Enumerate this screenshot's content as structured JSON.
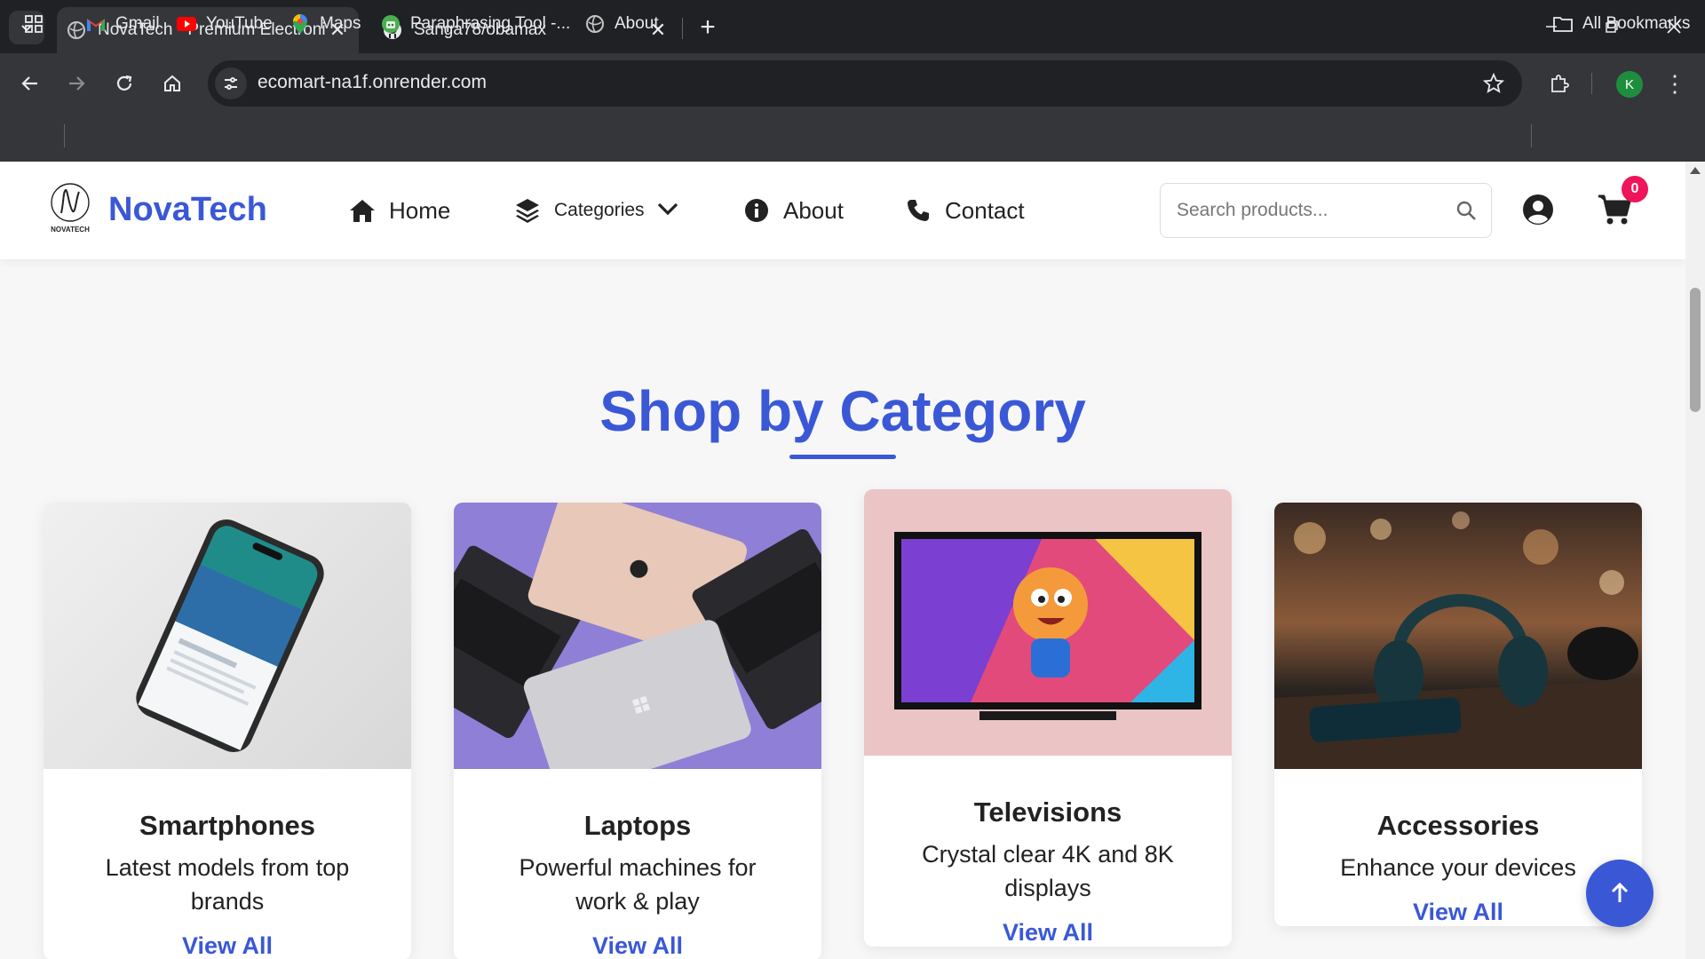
{
  "browser": {
    "tabs": [
      {
        "title": "NovaTech - Premium Electronics",
        "active": true
      },
      {
        "title": "Sanga78/obamax",
        "active": false
      }
    ],
    "url": "ecomart-na1f.onrender.com",
    "profile_initial": "K",
    "bookmarks": [
      "Gmail",
      "YouTube",
      "Maps",
      "Paraphrasing Tool -...",
      "About"
    ],
    "all_bookmarks": "All Bookmarks"
  },
  "site": {
    "brand": "NovaTech",
    "logo_text": "NOVATECH",
    "nav": {
      "home": "Home",
      "categories": "Categories",
      "about": "About",
      "contact": "Contact"
    },
    "search_placeholder": "Search products...",
    "cart_count": "0"
  },
  "section": {
    "title": "Shop by Category"
  },
  "categories": [
    {
      "title": "Smartphones",
      "description": "Latest models from top brands",
      "link": "View All"
    },
    {
      "title": "Laptops",
      "description": "Powerful machines for work & play",
      "link": "View All"
    },
    {
      "title": "Televisions",
      "description": "Crystal clear 4K and 8K displays",
      "link": "View All"
    },
    {
      "title": "Accessories",
      "description": "Enhance your devices",
      "link": "View All"
    }
  ],
  "colors": {
    "brand": "#3a58d6",
    "badge": "#f0145a",
    "tv_bg": "#ebc4c6",
    "laptop_bg": "#8f7fd6"
  }
}
